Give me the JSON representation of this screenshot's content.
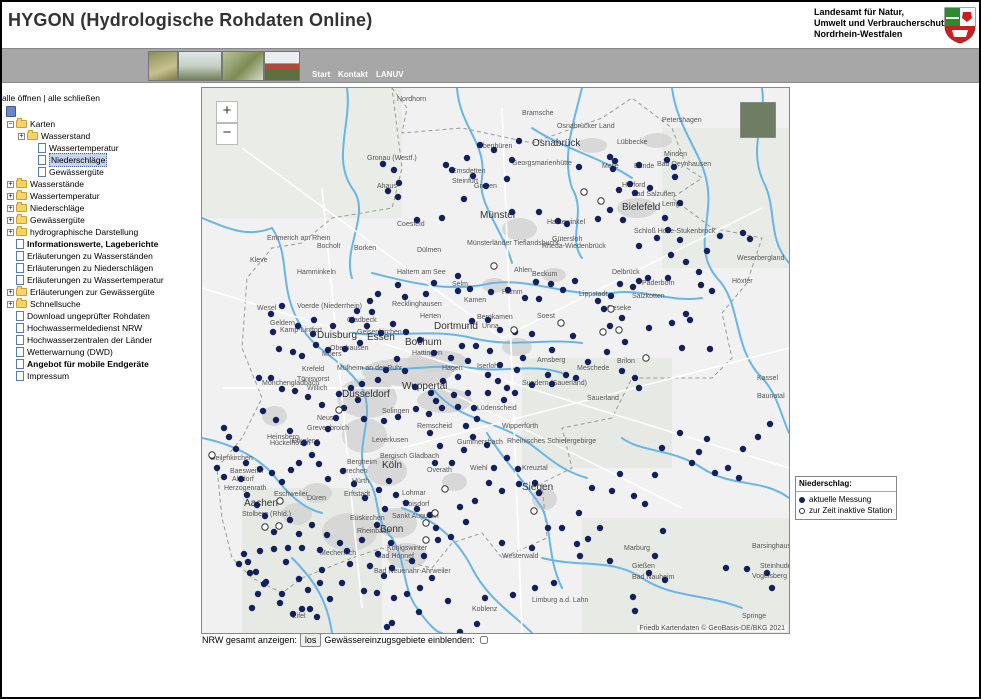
{
  "header": {
    "title": "HYGON (Hydrologische Rohdaten Online)",
    "agency_lines": [
      "Landesamt für Natur,",
      "Umwelt und Verbraucherschutz",
      "Nordrhein-Westfalen"
    ]
  },
  "nav": {
    "links": [
      "Start",
      "Kontakt",
      "LANUV"
    ]
  },
  "tree": {
    "expand_all": "alle öffnen",
    "separator": "|",
    "collapse_all": "alle schließen",
    "items": [
      {
        "label": "Karten",
        "depth": 0,
        "icon": "folder",
        "toggle": "−"
      },
      {
        "label": "Wasserstand",
        "depth": 1,
        "icon": "folder",
        "toggle": "+"
      },
      {
        "label": "Wassertemperatur",
        "depth": 2,
        "icon": "doc",
        "toggle": ""
      },
      {
        "label": "Niederschläge",
        "depth": 2,
        "icon": "doc",
        "toggle": "",
        "selected": true
      },
      {
        "label": "Gewässergüte",
        "depth": 2,
        "icon": "doc",
        "toggle": ""
      },
      {
        "label": "Wasserstände",
        "depth": 0,
        "icon": "folder",
        "toggle": "+"
      },
      {
        "label": "Wassertemperatur",
        "depth": 0,
        "icon": "folder",
        "toggle": "+"
      },
      {
        "label": "Niederschläge",
        "depth": 0,
        "icon": "folder",
        "toggle": "+"
      },
      {
        "label": "Gewässergüte",
        "depth": 0,
        "icon": "folder",
        "toggle": "+"
      },
      {
        "label": "hydrographische Darstellung",
        "depth": 0,
        "icon": "folder",
        "toggle": "+"
      },
      {
        "label": "Informationswerte, Lageberichte",
        "depth": 0,
        "icon": "doc",
        "toggle": "",
        "bold": true
      },
      {
        "label": "Erläuterungen zu Wasserständen",
        "depth": 0,
        "icon": "doc",
        "toggle": ""
      },
      {
        "label": "Erläuterungen zu Niederschlägen",
        "depth": 0,
        "icon": "doc",
        "toggle": ""
      },
      {
        "label": "Erläuterungen zu Wassertemperatur",
        "depth": 0,
        "icon": "doc",
        "toggle": ""
      },
      {
        "label": "Erläuterungen zur Gewässergüte",
        "depth": 0,
        "icon": "folder",
        "toggle": "+"
      },
      {
        "label": "Schnellsuche",
        "depth": 0,
        "icon": "folder",
        "toggle": "+"
      },
      {
        "label": "Download ungeprüfter Rohdaten",
        "depth": 0,
        "icon": "doc",
        "toggle": ""
      },
      {
        "label": "Hochwassermeldedienst NRW",
        "depth": 0,
        "icon": "doc",
        "toggle": ""
      },
      {
        "label": "Hochwasserzentralen der Länder",
        "depth": 0,
        "icon": "doc",
        "toggle": ""
      },
      {
        "label": "Wetterwarnung (DWD)",
        "depth": 0,
        "icon": "doc",
        "toggle": ""
      },
      {
        "label": "Angebot für mobile Endgeräte",
        "depth": 0,
        "icon": "doc",
        "toggle": "",
        "bold": true
      },
      {
        "label": "Impressum",
        "depth": 0,
        "icon": "doc",
        "toggle": ""
      }
    ]
  },
  "map": {
    "zoom_in": "+",
    "zoom_out": "−",
    "attribution": "Friedb Kartendaten © GeoBasis-DE/BKG 2021",
    "place_labels": [
      "Nordhorn",
      "Bramsche",
      "Osnabrücker Land",
      "Lübbecke",
      "Petershagen",
      "Ibbenbüren",
      "Osnabrück",
      "Georgsmarienhütte",
      "Melle",
      "Bünde",
      "Minden",
      "Bad Oeynhausen",
      "Gronau (Westf.)",
      "Emsdetten",
      "Steinfurt",
      "Herford",
      "Bad Salzuflen",
      "Ahaus",
      "Greven",
      "Bielefeld",
      "Lemgo",
      "Coesfeld",
      "Münster",
      "Harsewinkel",
      "Gütersloh",
      "Schloß Holte-Stukenbrock",
      "Münsterländer Tieflandsbucht",
      "Emmerich am Rhein",
      "Bocholt",
      "Borken",
      "Dülmen",
      "Rheda-Wiedenbrück",
      "Kleve",
      "Hamminkeln",
      "Haltern am See",
      "Ahlen",
      "Beckum",
      "Delbrück",
      "Paderborn",
      "Höxter",
      "Weserbergland",
      "Selm",
      "Hamm",
      "Kamen",
      "Bergkamen",
      "Lippstadt",
      "Geseke",
      "Salzkotten",
      "Wesel",
      "Voerde (Niederrhein)",
      "Recklinghausen",
      "Herten",
      "Soest",
      "Unna",
      "Geldern",
      "Kamp-Lintfort",
      "Gladbeck",
      "Gelsenkirchen",
      "Dortmund",
      "Duisburg",
      "Oberhausen",
      "Essen",
      "Bochum",
      "Moers",
      "Mülheim an der Ruhr",
      "Hattingen",
      "Hagen",
      "Iserlohn",
      "Arnsberg",
      "Brilon",
      "Krefeld",
      "Tönisvorst",
      "Willich",
      "Wuppertal",
      "Meschede",
      "Sundern (Sauerland)",
      "Düsseldorf",
      "Mönchengladbach",
      "Neuss",
      "Solingen",
      "Lüdenscheid",
      "Sauerland",
      "Kassel",
      "Baunatal",
      "Grevenbroich",
      "Remscheid",
      "Wipperfürth",
      "Heinsberg",
      "Hückelhoven",
      "Erkelenz",
      "Leverkusen",
      "Gummersbach",
      "Rheinisches Schiefergebirge",
      "Geilenkirchen",
      "Bergheim",
      "Bergisch Gladbach",
      "Köln",
      "Frechen",
      "Hürth",
      "Overath",
      "Wiehl",
      "Kreuztal",
      "Siegen",
      "Baesweiler",
      "Alsdorf",
      "Herzogenrath",
      "Eschweiler",
      "Düren",
      "Aachen",
      "Stolberg (Rhld.)",
      "Euskirchen",
      "Rheinbach",
      "Erftstadt",
      "Lohmar",
      "Troisdorf",
      "Sankt Augustin",
      "Bonn",
      "Königswinter",
      "Bad Honnef",
      "Mechernich",
      "Bad Neuenahr-Ahrweiler",
      "Westerwald",
      "Limburg a.d. Lahn",
      "Koblenz",
      "Bad Nauheim",
      "Gießen",
      "Vogelsberg",
      "Marburg",
      "Eifel",
      "Springe",
      "Barsinghausen",
      "Steinhude"
    ]
  },
  "legend": {
    "title": "Niederschlag:",
    "active": "aktuelle Messung",
    "inactive": "zur Zeit inaktive Station"
  },
  "controls": {
    "nrw_label": "NRW gesamt anzeigen:",
    "button": "los",
    "catchment_label": "Gewässereinzugsgebiete einblenden:"
  },
  "colors": {
    "active_station": "#12205c",
    "inactive_station": "#ffffff",
    "water": "#68b5e6",
    "navbar": "#a7a7a7",
    "urban": "#d3d3d3"
  }
}
